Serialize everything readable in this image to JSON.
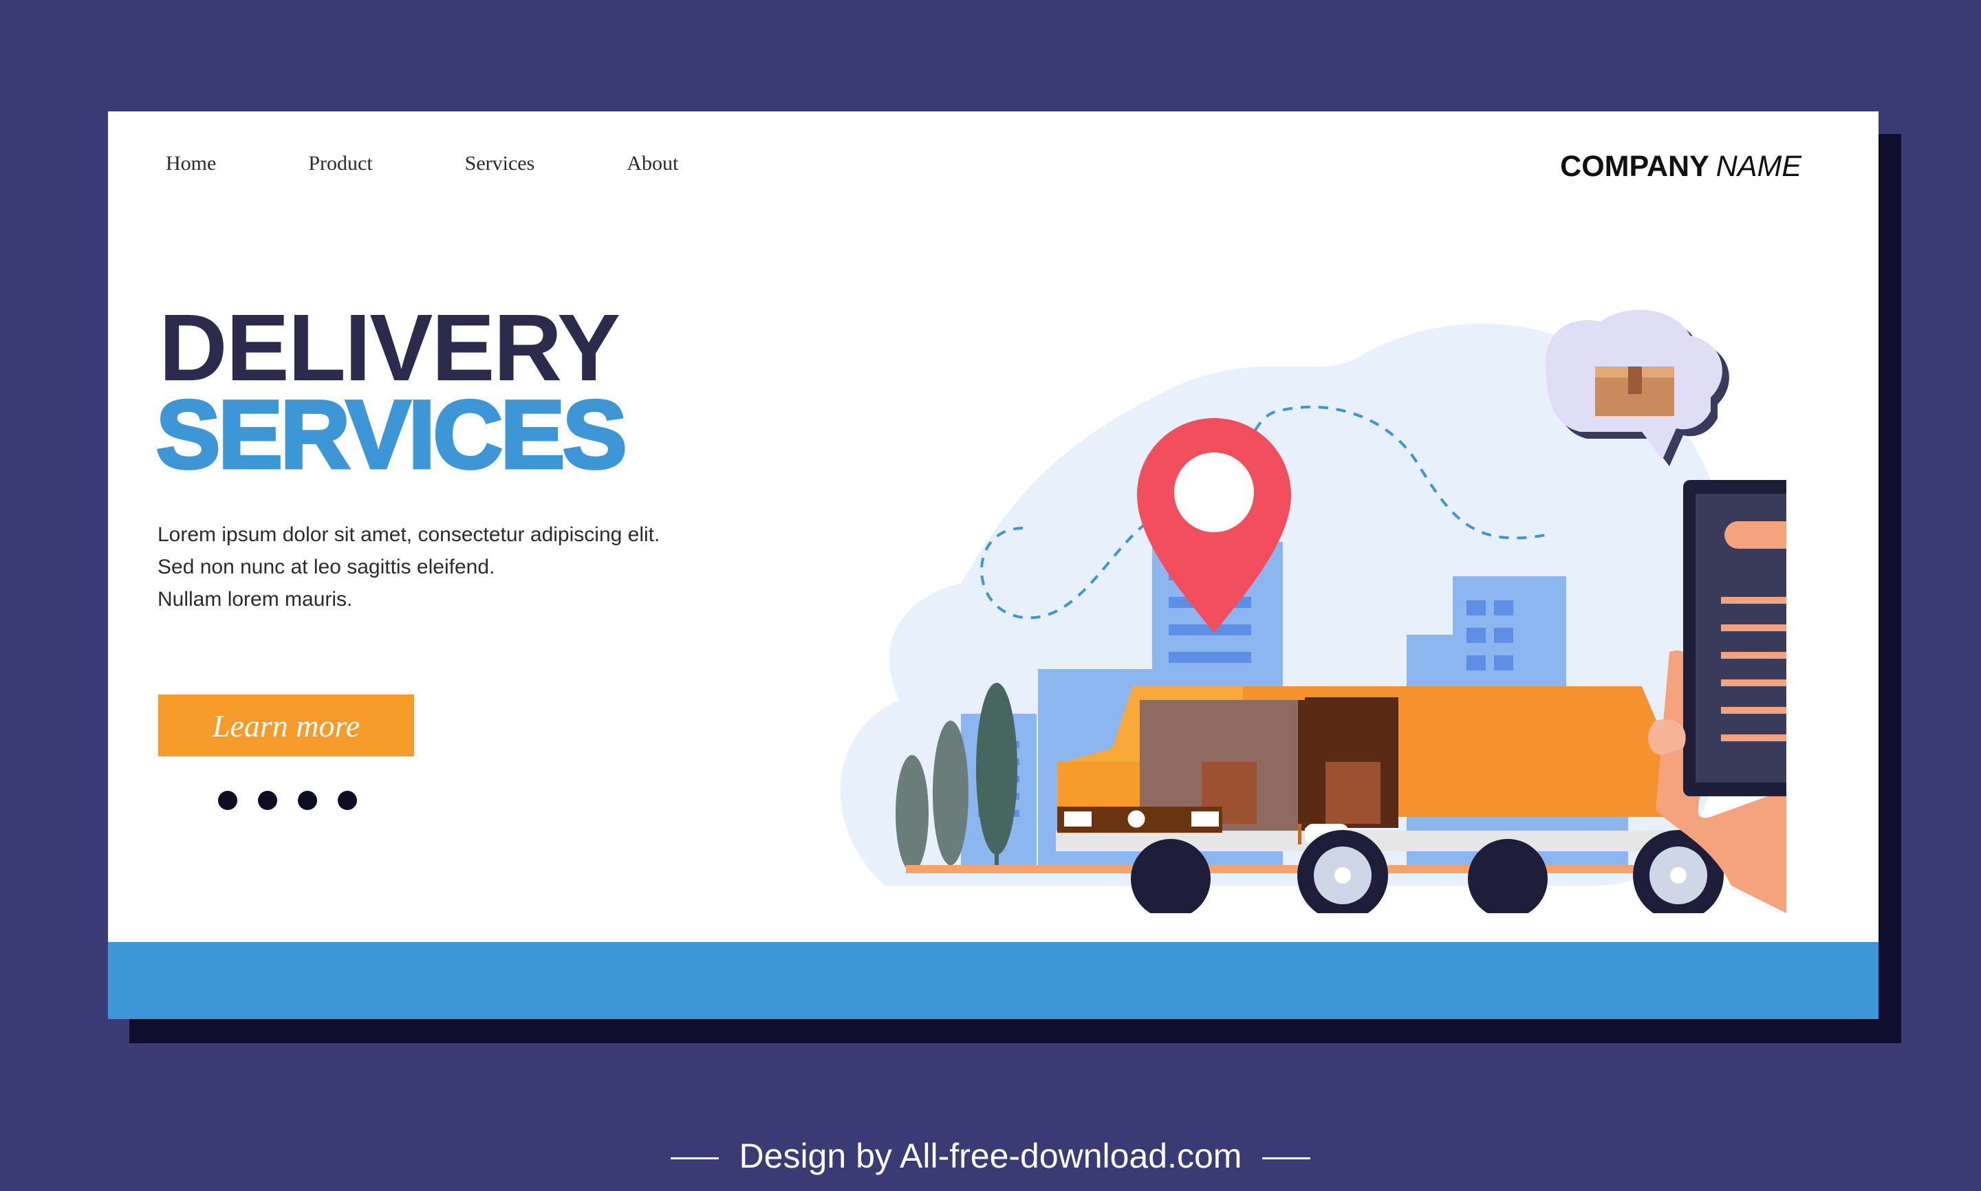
{
  "nav": {
    "items": [
      {
        "label": "Home"
      },
      {
        "label": "Product"
      },
      {
        "label": "Services"
      },
      {
        "label": "About"
      }
    ]
  },
  "brand": {
    "bold": "COMPANY",
    "italic": "NAME"
  },
  "hero": {
    "title_line1": "DELIVERY",
    "title_line2": "SERVICES",
    "body_lines": [
      "Lorem ipsum dolor sit amet, consectetur adipiscing elit.",
      "Sed non nunc at leo sagittis eleifend.",
      "Nullam lorem mauris."
    ],
    "cta_label": "Learn more",
    "pager_dots": 4
  },
  "footer": {
    "credit": "Design by All-free-download.com"
  },
  "colors": {
    "background": "#3a3a75",
    "accent_blue": "#3d96d6",
    "accent_orange": "#f79b2b",
    "title_dark": "#2c2b4e",
    "pin_red": "#f24e5e"
  },
  "icons": [
    "location-pin-icon",
    "package-box-icon",
    "smartphone-icon",
    "delivery-van-icon"
  ]
}
